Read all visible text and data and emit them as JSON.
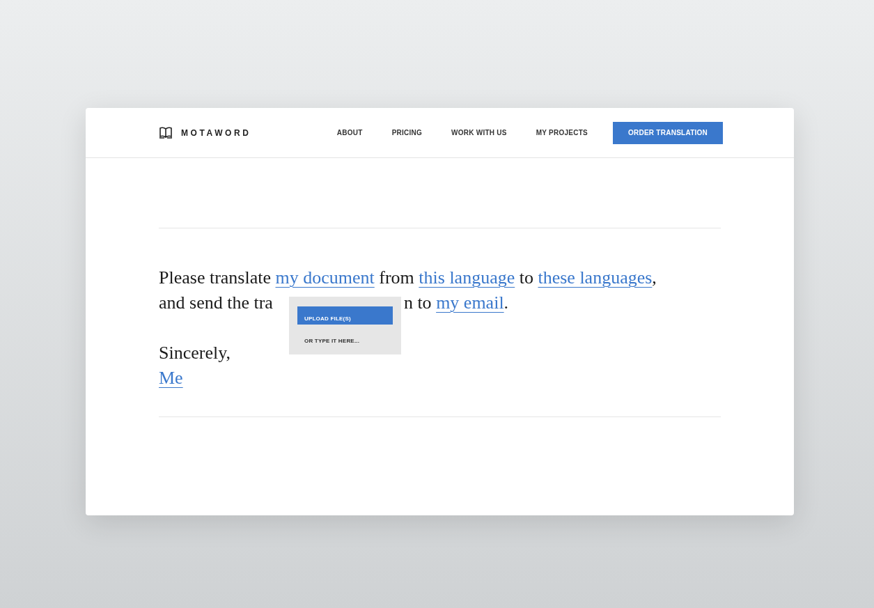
{
  "header": {
    "logo": "MOTAWORD",
    "nav": [
      {
        "label": "ABOUT"
      },
      {
        "label": "PRICING"
      },
      {
        "label": "WORK WITH US"
      },
      {
        "label": "MY PROJECTS"
      }
    ],
    "cta": "ORDER TRANSLATION"
  },
  "letter": {
    "lines": [
      {
        "segments": [
          {
            "kind": "text",
            "text": "Please translate "
          },
          {
            "kind": "link",
            "text": "my document"
          },
          {
            "kind": "text",
            "text": " from "
          },
          {
            "kind": "link",
            "text": "this language"
          },
          {
            "kind": "text",
            "text": " to "
          },
          {
            "kind": "link",
            "text": "these languages"
          },
          {
            "kind": "text",
            "text": ","
          }
        ]
      },
      {
        "segments": [
          {
            "kind": "text",
            "text": "and send the tra"
          },
          {
            "kind": "covered"
          },
          {
            "kind": "text",
            "text": "n to "
          },
          {
            "kind": "link",
            "text": "my email"
          },
          {
            "kind": "text",
            "text": "."
          }
        ]
      }
    ],
    "closing": "Sincerely,",
    "signature": "Me"
  },
  "popup": {
    "items": [
      {
        "label": "UPLOAD FILE(S)",
        "selected": true
      },
      {
        "label": "OR TYPE IT HERE...",
        "selected": false
      }
    ]
  }
}
